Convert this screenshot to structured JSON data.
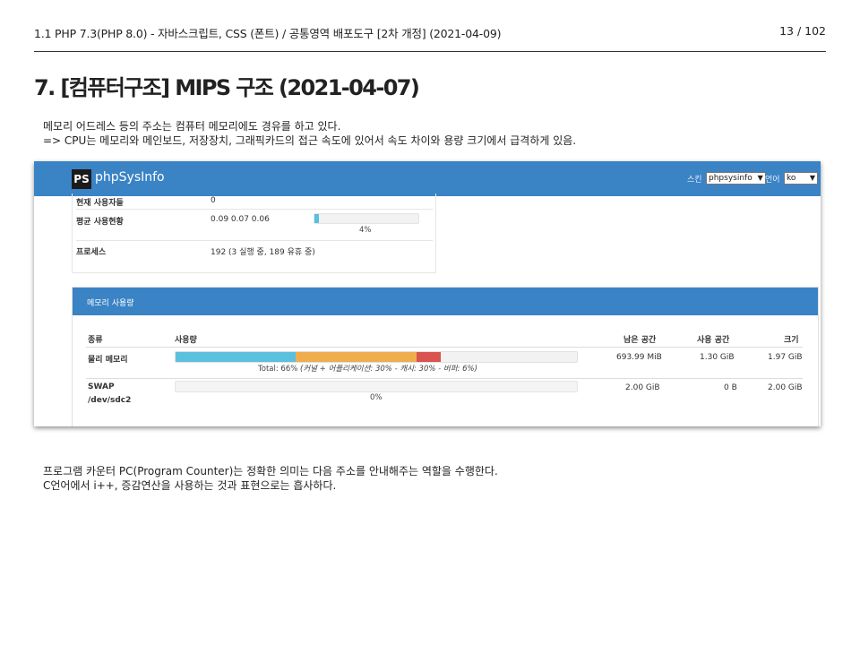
{
  "header": {
    "left": "1.1 PHP 7.3(PHP 8.0) - 자바스크립트, CSS (폰트) / 공통영역 배포도구 [2차 개정] (2021-04-09)",
    "page": "13 / 102"
  },
  "title": "7. [컴퓨터구조] MIPS 구조 (2021-04-07)",
  "intro": {
    "line1": "메모리 어드레스 등의 주소는 컴퓨터 메모리에도 경유를 하고 있다.",
    "line2": "=> CPU는 메모리와 메인보드, 저장장치, 그래픽카드의 접근 속도에 있어서 속도 차이와 용량 크기에서 급격하게 있음."
  },
  "screenshot": {
    "app_name": "phpSysInfo",
    "logo_text": "PS",
    "skin_label": "스킨",
    "skin_value": "phpsysinfo",
    "lang_label": "언어",
    "lang_value": "ko",
    "system": {
      "rows": [
        {
          "label": "현재 사용자들",
          "value": "0"
        },
        {
          "label": "평균 사용현황",
          "value": "0.09 0.07 0.06"
        },
        {
          "label": "프로세스",
          "value": "192 (3 실행 중, 189 유휴 중)"
        }
      ],
      "load_percent": 4,
      "load_label": "4%"
    },
    "memory": {
      "panel_title": "메모리 사용량",
      "columns": [
        "종류",
        "사용량",
        "남은 공간",
        "사용 공간",
        "크기"
      ],
      "physical": {
        "type": "물리 메모리",
        "segments": [
          {
            "name": "커널 + 어플리케이션",
            "percent": 30,
            "color": "#5bc0de"
          },
          {
            "name": "캐시",
            "percent": 30,
            "color": "#f0ad4e"
          },
          {
            "name": "버퍼",
            "percent": 6,
            "color": "#d9534f"
          }
        ],
        "total_text": "Total: 66%",
        "detail_text": "(커널 + 어플리케이션: 30% - 캐시: 30% - 버퍼: 6%)",
        "free": "693.99 MiB",
        "used": "1.30 GiB",
        "size": "1.97 GiB"
      },
      "swap": {
        "type": "SWAP",
        "device": "/dev/sdc2",
        "percent": 0,
        "percent_label": "0%",
        "free": "2.00 GiB",
        "used": "0 B",
        "size": "2.00 GiB"
      }
    }
  },
  "outro": {
    "line1": "프로그램 카운터 PC(Program Counter)는 정확한 의미는 다음 주소를 안내해주는 역할을 수행한다.",
    "line2": "C언어에서 i++, 증감연산을 사용하는 것과 표현으로는 흡사하다."
  }
}
